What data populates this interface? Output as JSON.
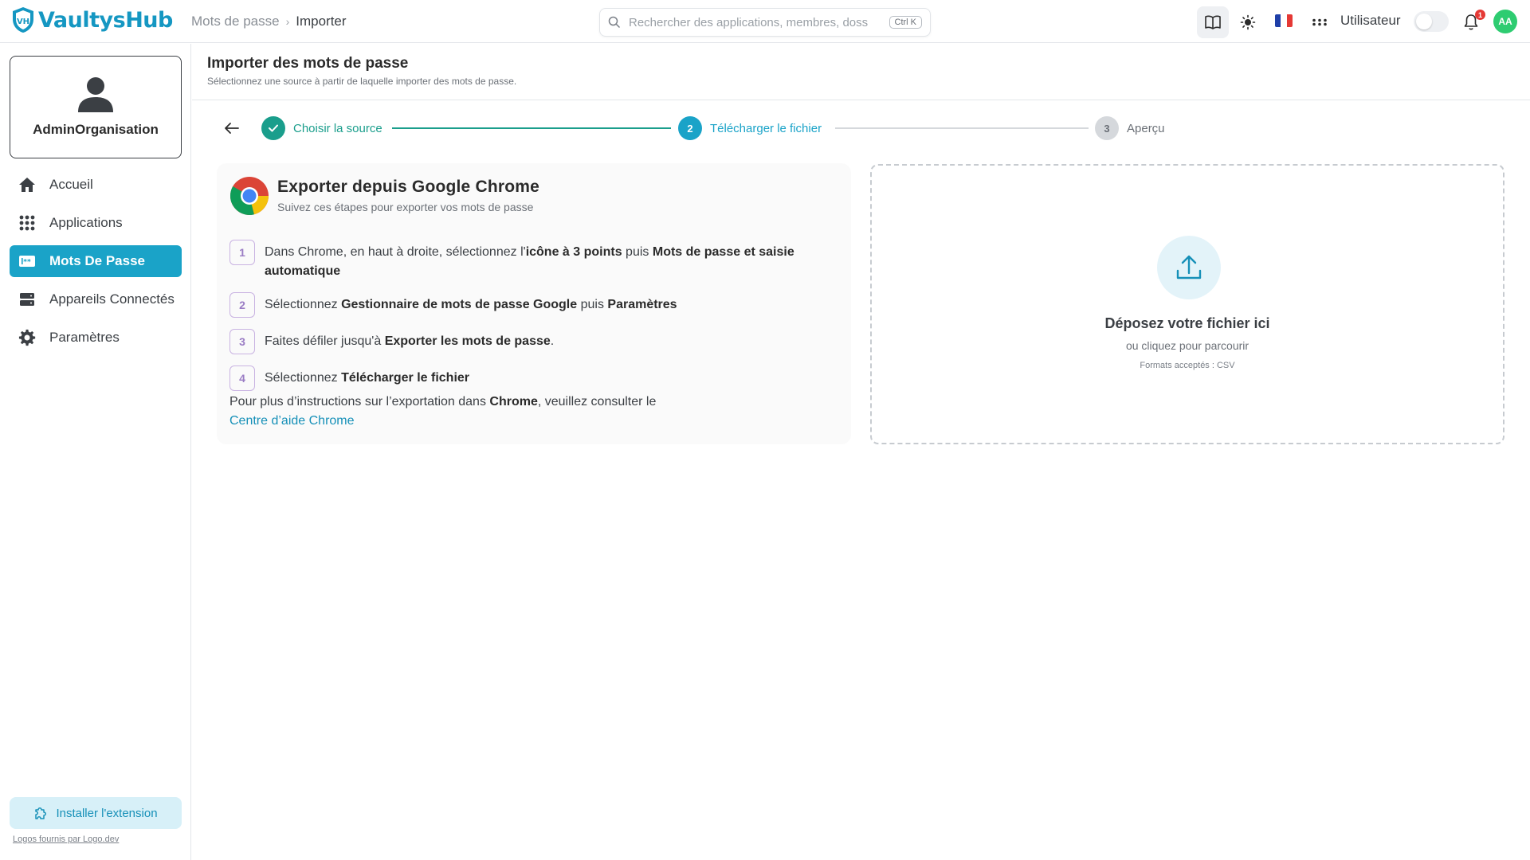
{
  "app": {
    "name": "VaultysHub",
    "logo_badge": "VH"
  },
  "breadcrumb": {
    "parent": "Mots de passe",
    "current": "Importer"
  },
  "search": {
    "placeholder": "Rechercher des applications, membres, doss",
    "shortcut": "Ctrl K"
  },
  "topbar": {
    "user_label": "Utilisateur",
    "notification_count": "1",
    "avatar_initials": "AA",
    "icons": [
      "book-icon",
      "sun-icon",
      "flag-fr-icon",
      "dots-menu-icon",
      "bell-icon"
    ]
  },
  "sidebar": {
    "profile_name": "AdminOrganisation",
    "items": [
      {
        "label": "Accueil",
        "icon": "home-icon",
        "active": false
      },
      {
        "label": "Applications",
        "icon": "grid-icon",
        "active": false
      },
      {
        "label": "Mots De Passe",
        "icon": "password-icon",
        "active": true
      },
      {
        "label": "Appareils Connectés",
        "icon": "devices-icon",
        "active": false
      },
      {
        "label": "Paramètres",
        "icon": "gear-icon",
        "active": false
      }
    ],
    "install_label": "Installer l'extension",
    "logos_note": "Logos fournis par Logo.dev"
  },
  "page": {
    "title": "Importer des mots de passe",
    "subtitle": "Sélectionnez une source à partir de laquelle importer des mots de passe."
  },
  "stepper": {
    "steps": [
      {
        "number": "1",
        "label": "Choisir la source",
        "state": "done"
      },
      {
        "number": "2",
        "label": "Télécharger le fichier",
        "state": "active"
      },
      {
        "number": "3",
        "label": "Aperçu",
        "state": "pending"
      }
    ]
  },
  "instructions": {
    "title": "Exporter depuis Google Chrome",
    "subtitle": "Suivez ces étapes pour exporter vos mots de passe",
    "steps": [
      {
        "number": "1",
        "text_a": "Dans Chrome, en haut à droite, sélectionnez l'",
        "bold_a": "icône à 3 points",
        "text_b": " puis ",
        "bold_b": "Mots de passe et saisie automatique"
      },
      {
        "number": "2",
        "text_a": "Sélectionnez ",
        "bold_a": "Gestionnaire de mots de passe Google",
        "text_b": " puis ",
        "bold_b": "Paramètres"
      },
      {
        "number": "3",
        "text_a": "Faites défiler jusqu'à ",
        "bold_a": "Exporter les mots de passe",
        "text_b": ".",
        "bold_b": ""
      },
      {
        "number": "4",
        "text_a": "Sélectionnez ",
        "bold_a": "Télécharger le fichier",
        "text_b": "",
        "bold_b": ""
      }
    ],
    "footer_text": "Pour plus d’instructions sur l’exportation dans ",
    "footer_bold": "Chrome",
    "footer_tail": ", veuillez consulter le",
    "help_link": "Centre d’aide Chrome"
  },
  "dropzone": {
    "title": "Déposez votre fichier ici",
    "subtitle": "ou cliquez pour parcourir",
    "formats": "Formats acceptés : CSV"
  },
  "colors": {
    "accent": "#1aa3c8",
    "done": "#1a9e8c",
    "pending": "#d5d8dc",
    "brand": "#1597c2"
  }
}
